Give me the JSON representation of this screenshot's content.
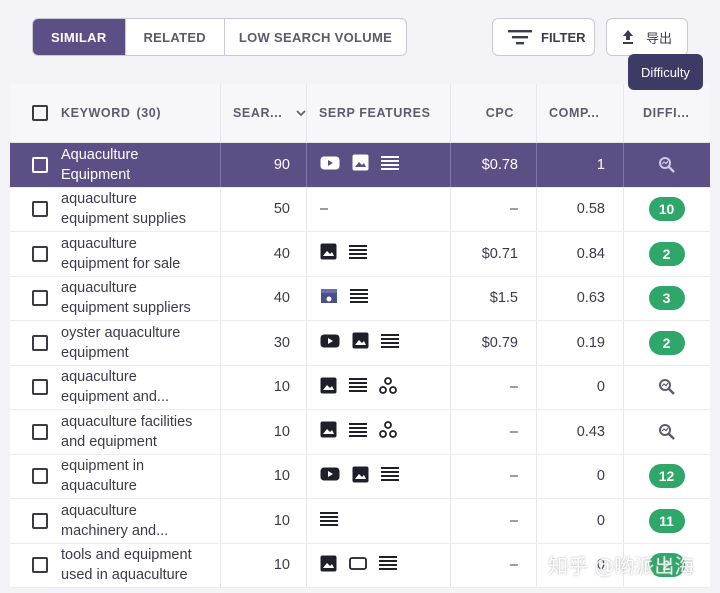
{
  "tabs": [
    {
      "label": "SIMILAR",
      "active": true
    },
    {
      "label": "RELATED",
      "active": false
    },
    {
      "label": "LOW SEARCH VOLUME",
      "active": false
    }
  ],
  "toolbar": {
    "filter_label": "FILTER",
    "export_label": "导出",
    "tooltip": "Difficulty"
  },
  "table": {
    "headers": {
      "keyword": "KEYWORD",
      "keyword_count": "(30)",
      "search": "SEAR...",
      "serp": "SERP FEATURES",
      "cpc": "CPC",
      "comp": "COMP...",
      "difficulty": "DIFFI..."
    },
    "rows": [
      {
        "kw1": "Aquaculture",
        "kw2": "Equipment",
        "search": "90",
        "serp": [
          "video-icon",
          "image-icon",
          "list-icon"
        ],
        "cpc": "$0.78",
        "comp": "1",
        "diff": null,
        "highlight": true
      },
      {
        "kw1": "aquaculture",
        "kw2": "equipment supplies",
        "search": "50",
        "serp_text": "–",
        "serp": [],
        "cpc": "–",
        "comp": "0.58",
        "diff": "10"
      },
      {
        "kw1": "aquaculture",
        "kw2": "equipment for sale",
        "search": "40",
        "serp": [
          "image-icon",
          "list-icon"
        ],
        "cpc": "$0.71",
        "comp": "0.84",
        "diff": "2"
      },
      {
        "kw1": "aquaculture",
        "kw2": "equipment suppliers",
        "search": "40",
        "serp": [
          "store-icon",
          "list-icon"
        ],
        "cpc": "$1.5",
        "comp": "0.63",
        "diff": "3"
      },
      {
        "kw1": "oyster aquaculture",
        "kw2": "equipment",
        "search": "30",
        "serp": [
          "video-icon",
          "image-icon",
          "list-icon"
        ],
        "cpc": "$0.79",
        "comp": "0.19",
        "diff": "2"
      },
      {
        "kw1": "aquaculture",
        "kw2": "equipment and...",
        "search": "10",
        "serp": [
          "image-icon",
          "list-icon",
          "network-icon"
        ],
        "cpc": "–",
        "comp": "0",
        "diff": null
      },
      {
        "kw1": "aquaculture facilities",
        "kw2": "and equipment",
        "search": "10",
        "serp": [
          "image-icon",
          "list-icon",
          "network-icon"
        ],
        "cpc": "–",
        "comp": "0.43",
        "diff": null
      },
      {
        "kw1": "equipment in",
        "kw2": "aquaculture",
        "search": "10",
        "serp": [
          "video-icon",
          "image-icon",
          "list-icon"
        ],
        "cpc": "–",
        "comp": "0",
        "diff": "12"
      },
      {
        "kw1": "aquaculture",
        "kw2": "machinery and...",
        "search": "10",
        "serp": [
          "list-icon"
        ],
        "cpc": "–",
        "comp": "0",
        "diff": "11"
      },
      {
        "kw1": "tools and equipment",
        "kw2": "used in aquaculture",
        "search": "10",
        "serp": [
          "image-icon",
          "rect-icon",
          "list-icon"
        ],
        "cpc": "–",
        "comp": "0",
        "diff": "2"
      }
    ]
  },
  "colors": {
    "accent": "#5b4f86",
    "badge_green": "#2fa66a",
    "tooltip_bg": "#3e3a66"
  },
  "watermark": "知乎 @哟派出海"
}
